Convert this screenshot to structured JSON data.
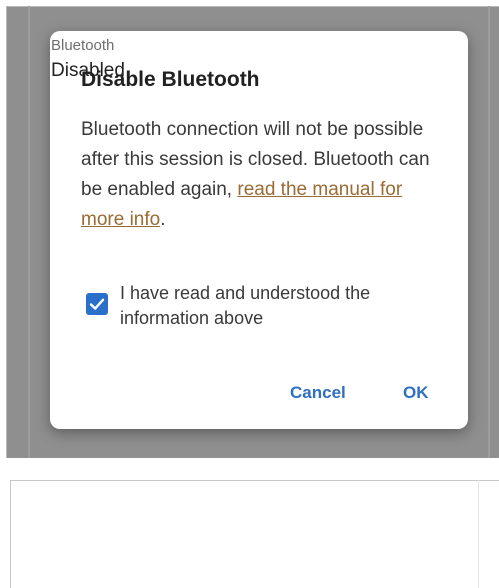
{
  "dialog": {
    "title": "Disable Bluetooth",
    "body_text": "Bluetooth connection will not be possible after this session is closed. Bluetooth can be enabled again, ",
    "link_text": "read the manual for more info",
    "body_suffix": ".",
    "checkbox": {
      "label": "I have read and understood the information above",
      "checked": true
    },
    "cancel_label": "Cancel",
    "ok_label": "OK"
  },
  "setting": {
    "label": "Bluetooth",
    "value": "Disabled"
  },
  "colors": {
    "accent": "#2e6fc0",
    "link": "#9a6b33",
    "scrim": "#8f8f8f"
  }
}
